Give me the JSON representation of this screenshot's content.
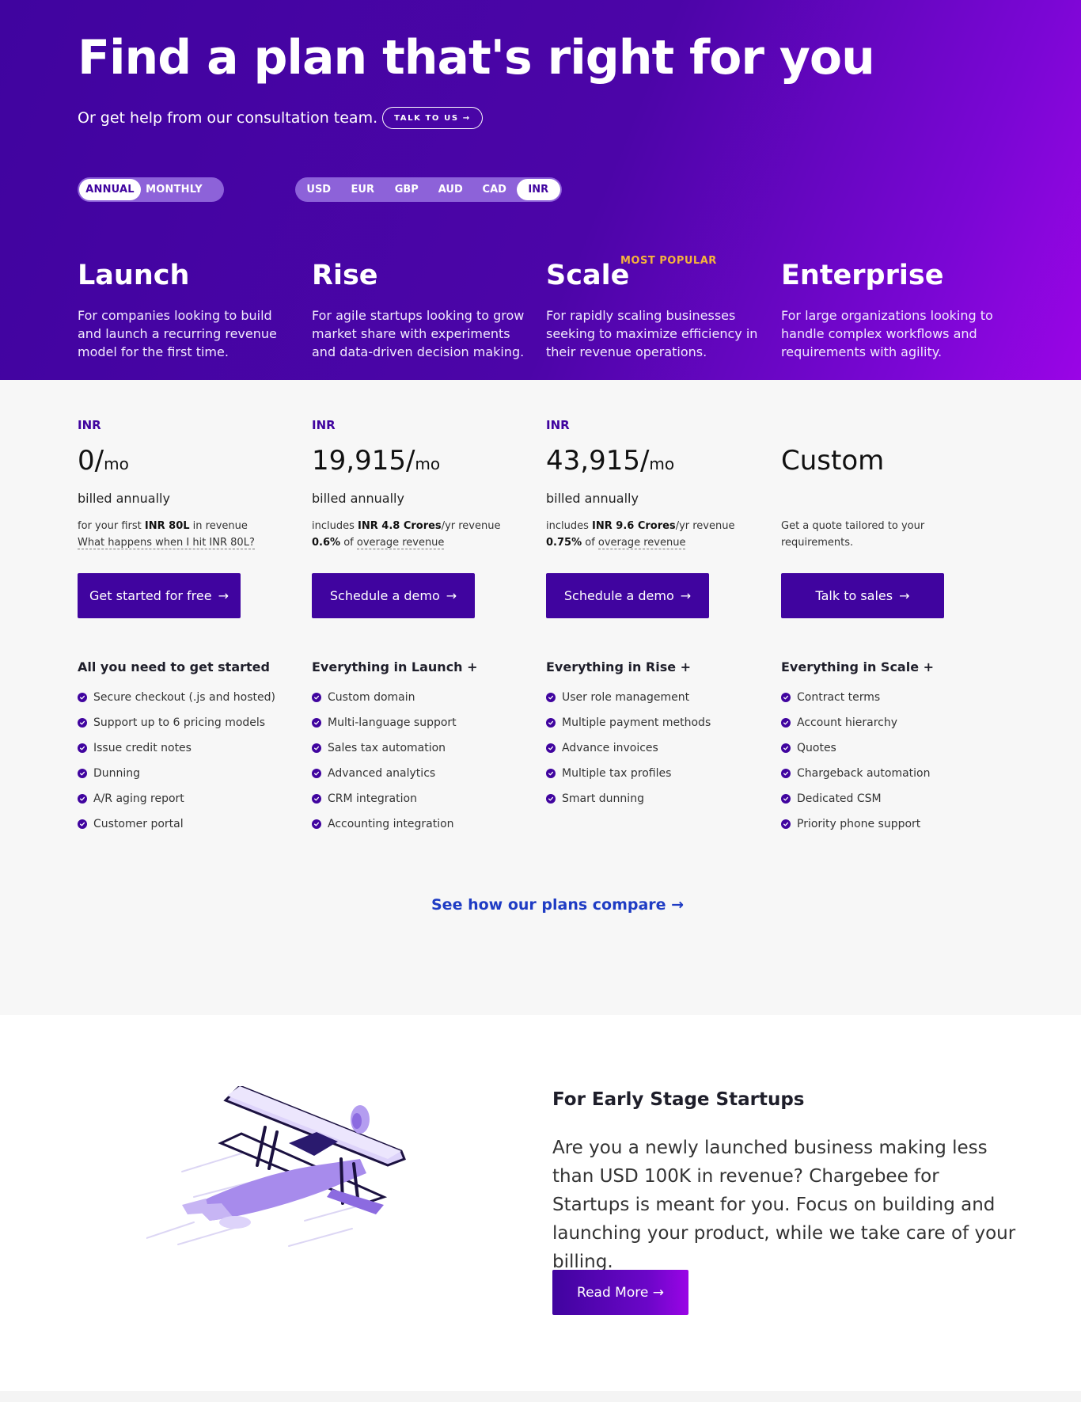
{
  "hero": {
    "title": "Find a plan that's right for you",
    "subtitle": "Or get help from our consultation team.",
    "talk_button": "TALK TO US →"
  },
  "billing_toggle": [
    {
      "label": "ANNUAL",
      "active": true
    },
    {
      "label": "MONTHLY",
      "active": false
    }
  ],
  "currencies": [
    {
      "label": "USD",
      "active": false
    },
    {
      "label": "EUR",
      "active": false
    },
    {
      "label": "GBP",
      "active": false
    },
    {
      "label": "AUD",
      "active": false
    },
    {
      "label": "CAD",
      "active": false
    },
    {
      "label": "INR",
      "active": true
    }
  ],
  "popular_badge": "MOST POPULAR",
  "plans": [
    {
      "name": "Launch",
      "description": "For companies looking to build and launch a recurring revenue model for the first time.",
      "currency": "INR",
      "amount": "0/",
      "per": "mo",
      "billed": "billed annually",
      "note_line1_pre": "for your first ",
      "note_line1_bold": "INR 80L",
      "note_line1_post": " in revenue",
      "note_line2_bold": "",
      "note_line2_dotted": "What happens when I hit INR 80L?",
      "cta": "Get started for free",
      "features_heading": "All you need to get started",
      "features": [
        "Secure checkout (.js and hosted)",
        "Support up to 6 pricing models",
        "Issue credit notes",
        "Dunning",
        "A/R aging report",
        "Customer portal"
      ]
    },
    {
      "name": "Rise",
      "description": "For agile startups looking to grow market share with experiments and data-driven decision making.",
      "currency": "INR",
      "amount": "19,915/",
      "per": "mo",
      "billed": "billed annually",
      "note_line1_pre": "includes ",
      "note_line1_bold": "INR 4.8 Crores",
      "note_line1_post": "/yr revenue",
      "note_line2_bold": "0.6%",
      "note_line2_pre": " of ",
      "note_line2_dotted": "overage revenue",
      "cta": "Schedule a demo",
      "features_heading": "Everything in Launch  +",
      "features": [
        "Custom domain",
        "Multi-language support",
        "Sales tax automation",
        "Advanced analytics",
        "CRM integration",
        "Accounting integration"
      ]
    },
    {
      "name": "Scale",
      "description": "For rapidly scaling businesses seeking to maximize efficiency in their revenue operations.",
      "currency": "INR",
      "amount": "43,915/",
      "per": "mo",
      "billed": "billed annually",
      "note_line1_pre": "includes ",
      "note_line1_bold": "INR 9.6 Crores",
      "note_line1_post": "/yr revenue",
      "note_line2_bold": "0.75%",
      "note_line2_pre": " of ",
      "note_line2_dotted": "overage revenue",
      "cta": "Schedule a demo",
      "features_heading": "Everything in Rise  +",
      "features": [
        "User role management",
        "Multiple payment methods",
        "Advance invoices",
        "Multiple tax profiles",
        "Smart dunning"
      ]
    },
    {
      "name": "Enterprise",
      "description": "For large organizations looking to handle complex workflows and requirements with agility.",
      "currency": "",
      "amount": "Custom",
      "per": "",
      "billed": "",
      "note_line1_pre": "Get a quote tailored to your",
      "note_line1_bold": "",
      "note_line1_post": "",
      "note_line2_bold": "",
      "note_line2_pre": "requirements.",
      "note_line2_dotted": "",
      "cta": "Talk to sales",
      "features_heading": "Everything in Scale  +",
      "features": [
        "Contract terms",
        "Account hierarchy",
        "Quotes",
        "Chargeback automation",
        "Dedicated CSM",
        "Priority phone support"
      ]
    }
  ],
  "compare_link": "See how our plans compare →",
  "startup": {
    "title": "For Early Stage Startups",
    "text": "Are you a newly launched business making less than USD 100K in revenue? Chargebee for Startups is meant for you. Focus on building and launching your product, while we take care of your billing.",
    "button": "Read More →"
  },
  "colors": {
    "brand": "#40049f",
    "accent_end": "#9a05e6",
    "popular": "#f5b33b",
    "link": "#1f3cc4"
  }
}
